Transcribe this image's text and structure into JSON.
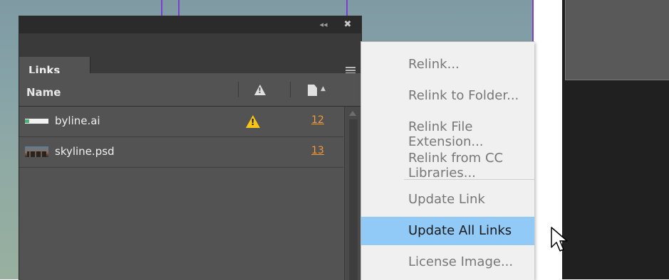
{
  "panel": {
    "tab_label": "Links",
    "columns": {
      "name": "Name"
    },
    "rows": [
      {
        "file": "byline.ai",
        "has_warning": true,
        "page": "12",
        "thumb": "byline-thumbnail"
      },
      {
        "file": "skyline.psd",
        "has_warning": false,
        "page": "13",
        "thumb": "skyline-thumbnail"
      }
    ],
    "icons": {
      "collapse": "collapse-icon",
      "close": "close-icon",
      "menu": "panel-menu-icon",
      "warning_column": "warning-icon",
      "page_column": "page-icon",
      "sort": "sort-ascending-icon"
    }
  },
  "menu": {
    "items": [
      {
        "label": "Relink...",
        "enabled": false
      },
      {
        "label": "Relink to Folder...",
        "enabled": false
      },
      {
        "label": "Relink File Extension...",
        "enabled": false
      },
      {
        "label": "Relink from CC Libraries...",
        "enabled": false
      },
      {
        "label": "Update Link",
        "enabled": false
      },
      {
        "label": "Update All Links",
        "enabled": true,
        "highlighted": true
      },
      {
        "label": "License Image...",
        "enabled": false
      }
    ]
  },
  "colors": {
    "panel_bg": "#535353",
    "menu_bg": "#f0f0f0",
    "menu_highlight": "#91c9f7",
    "warning": "#f5c518",
    "page_link": "#f29a38",
    "guide": "#7a3fd0"
  }
}
